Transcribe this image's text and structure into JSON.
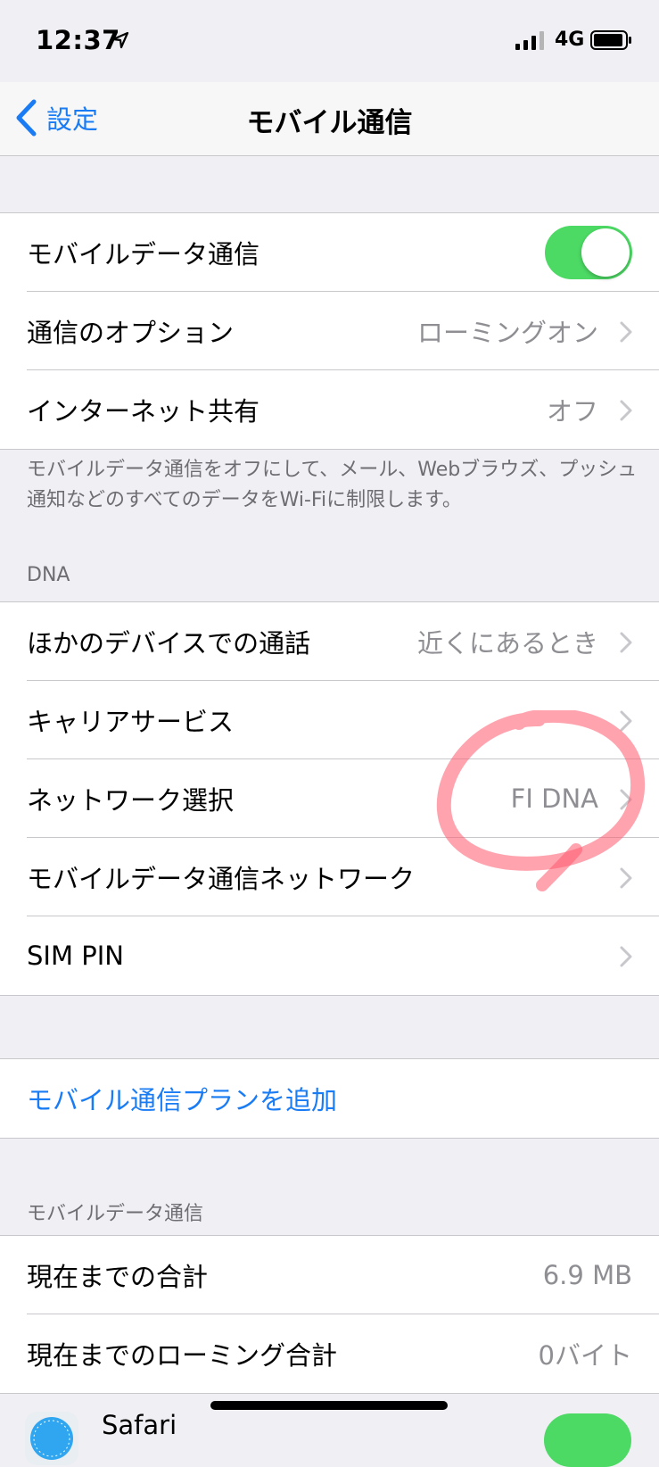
{
  "status_bar": {
    "time": "12:37",
    "network": "4G"
  },
  "nav": {
    "back_label": "設定",
    "title": "モバイル通信"
  },
  "cellular_group": {
    "mobile_data": {
      "label": "モバイルデータ通信",
      "toggle_on": true
    },
    "options": {
      "label": "通信のオプション",
      "value": "ローミングオン"
    },
    "hotspot": {
      "label": "インターネット共有",
      "value": "オフ"
    }
  },
  "footer_note": "モバイルデータ通信をオフにして、メール、Webブラウズ、プッシュ通知などのすべてのデータをWi-Fiに制限します。",
  "carrier_section": {
    "header": "DNA",
    "calls_other_devices": {
      "label": "ほかのデバイスでの通話",
      "value": "近くにあるとき"
    },
    "carrier_services": {
      "label": "キャリアサービス"
    },
    "network_selection": {
      "label": "ネットワーク選択",
      "value": "FI DNA"
    },
    "cellular_data_network": {
      "label": "モバイルデータ通信ネットワーク"
    },
    "sim_pin": {
      "label": "SIM PIN"
    }
  },
  "add_plan": {
    "label": "モバイル通信プランを追加"
  },
  "usage_section": {
    "header": "モバイルデータ通信",
    "current_total": {
      "label": "現在までの合計",
      "value": "6.9 MB"
    },
    "roaming_total": {
      "label": "現在までのローミング合計",
      "value": "0バイト"
    },
    "app_safari": {
      "label": "Safari"
    }
  },
  "colors": {
    "accent": "#1a7cf4",
    "toggle_on": "#4cd964",
    "background": "#efeff4",
    "annotation": "#ff5a6e"
  }
}
